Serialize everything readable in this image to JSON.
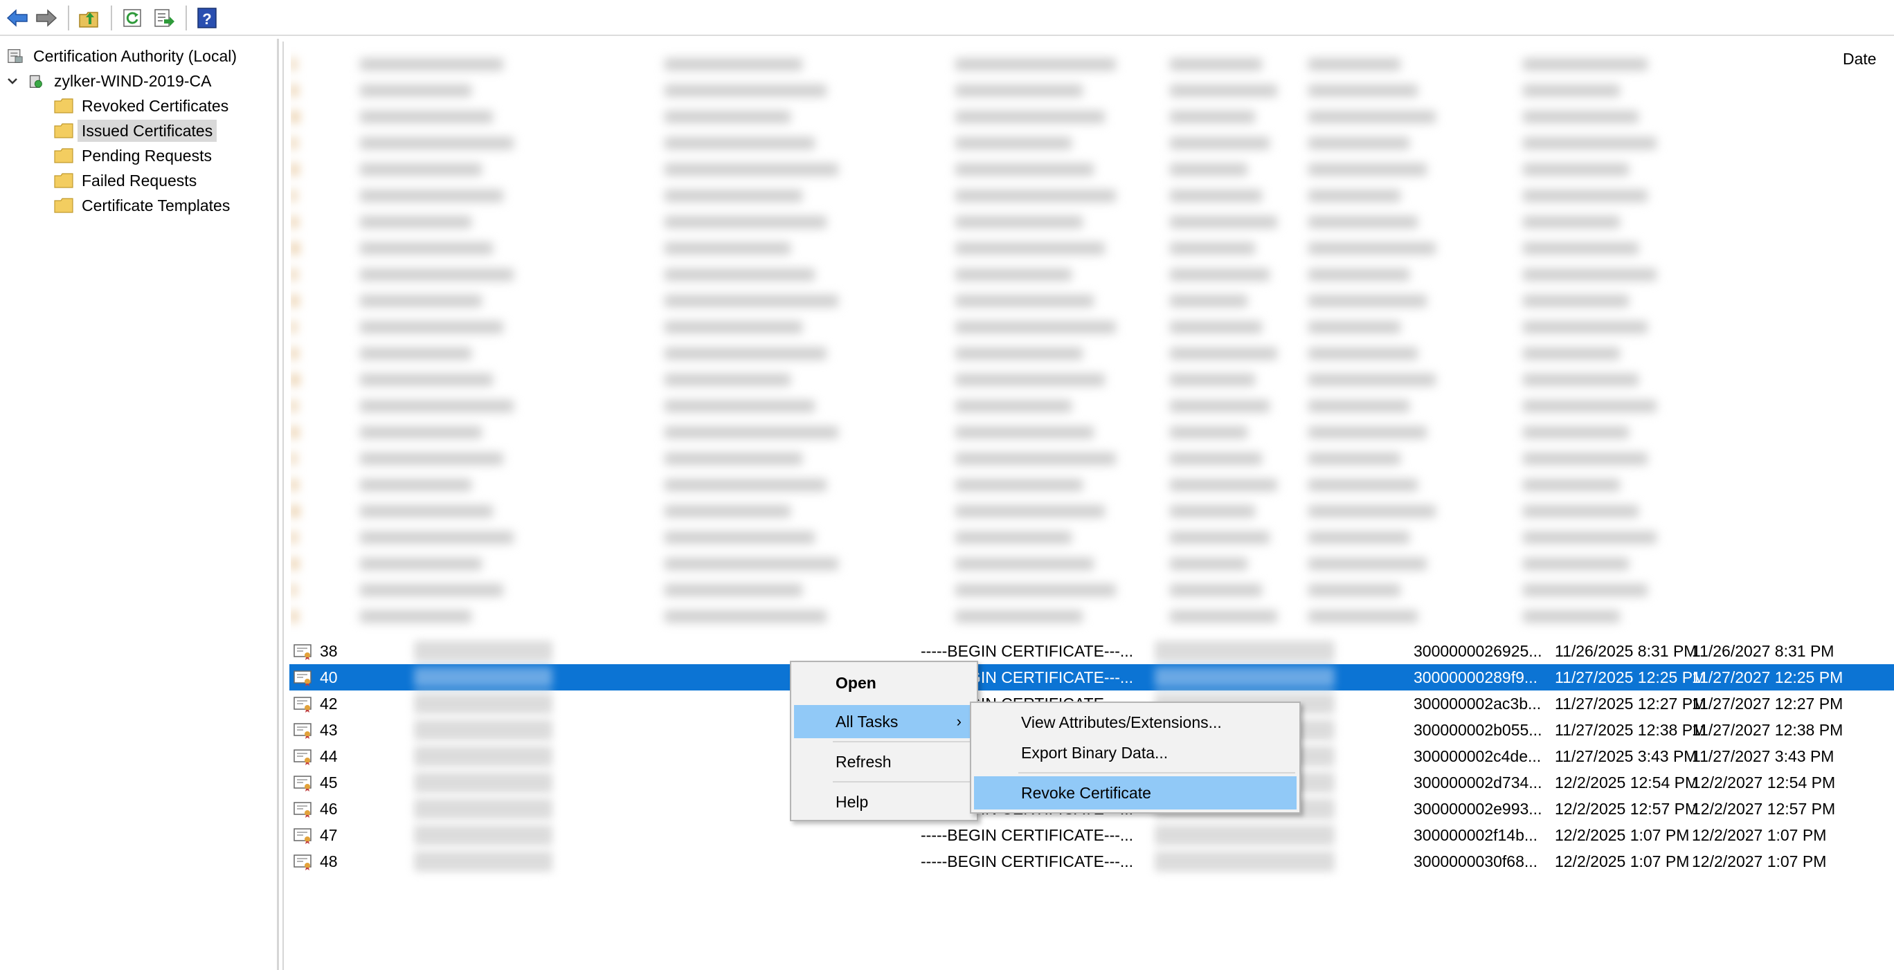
{
  "toolbar": {
    "buttons": [
      "back-icon",
      "forward-icon",
      "up-folder-icon",
      "refresh-icon",
      "export-list-icon",
      "help-icon"
    ]
  },
  "tree": {
    "root": "Certification Authority (Local)",
    "ca": "zylker-WIND-2019-CA",
    "folders": [
      "Revoked Certificates",
      "Issued Certificates",
      "Pending Requests",
      "Failed Requests",
      "Certificate Templates"
    ],
    "selected": "Issued Certificates"
  },
  "list": {
    "header_visible": "Date",
    "rows": [
      {
        "id": "38",
        "binary": "-----BEGIN CERTIFICATE---...",
        "serial": "3000000026925...",
        "effective": "11/26/2025 8:31 PM",
        "expiration": "11/26/2027 8:31 PM"
      },
      {
        "id": "40",
        "binary": "-----BEGIN CERTIFICATE---...",
        "serial": "30000000289f9...",
        "effective": "11/27/2025 12:25 PM",
        "expiration": "11/27/2027 12:25 PM"
      },
      {
        "id": "42",
        "binary": "-----BEGIN CERTIFICATE---...",
        "serial": "300000002ac3b...",
        "effective": "11/27/2025 12:27 PM",
        "expiration": "11/27/2027 12:27 PM"
      },
      {
        "id": "43",
        "binary": "-----BEGIN CERTIFICATE---...",
        "serial": "300000002b055...",
        "effective": "11/27/2025 12:38 PM",
        "expiration": "11/27/2027 12:38 PM"
      },
      {
        "id": "44",
        "binary": "-----BEGIN CERTIFICATE---...",
        "serial": "300000002c4de...",
        "effective": "11/27/2025 3:43 PM",
        "expiration": "11/27/2027 3:43 PM"
      },
      {
        "id": "45",
        "binary": "-----BEGIN CERTIFICATE---...",
        "serial": "300000002d734...",
        "effective": "12/2/2025 12:54 PM",
        "expiration": "12/2/2027 12:54 PM"
      },
      {
        "id": "46",
        "binary": "-----BEGIN CERTIFICATE---...",
        "serial": "300000002e993...",
        "effective": "12/2/2025 12:57 PM",
        "expiration": "12/2/2027 12:57 PM"
      },
      {
        "id": "47",
        "binary": "-----BEGIN CERTIFICATE---...",
        "serial": "300000002f14b...",
        "effective": "12/2/2025 1:07 PM",
        "expiration": "12/2/2027 1:07 PM"
      },
      {
        "id": "48",
        "binary": "-----BEGIN CERTIFICATE---...",
        "serial": "3000000030f68...",
        "effective": "12/2/2025 1:07 PM",
        "expiration": "12/2/2027 1:07 PM"
      }
    ],
    "selected_row": "40"
  },
  "context_menu": {
    "items": [
      "Open",
      "All Tasks",
      "Refresh",
      "Help"
    ]
  },
  "submenu": {
    "items": [
      "View Attributes/Extensions...",
      "Export Binary Data...",
      "Revoke Certificate"
    ],
    "highlighted": "Revoke Certificate"
  },
  "colors": {
    "selection": "#0c74d4",
    "menu_highlight": "#91c9f7",
    "menu_bg": "#f2f2f2"
  }
}
